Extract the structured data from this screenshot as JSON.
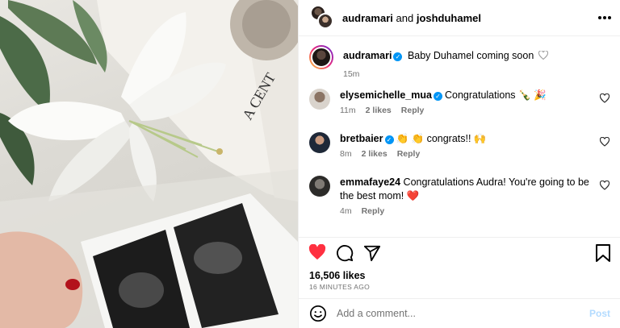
{
  "header": {
    "user1": "audramari",
    "conjunction": "and",
    "user2": "joshduhamel",
    "more_icon": "more-horizontal-icon"
  },
  "caption": {
    "username": "audramari",
    "text": "Baby Duhamel coming soon",
    "time": "15m"
  },
  "comments": [
    {
      "username": "elysemichelle_mua",
      "text": "Congratulations 🍾 🎉",
      "time": "11m",
      "likes": "2 likes",
      "reply": "Reply"
    },
    {
      "username": "bretbaier",
      "text": "👏 👏 congrats!! 🙌",
      "time": "8m",
      "likes": "2 likes",
      "reply": "Reply"
    },
    {
      "username": "emmafaye24",
      "text": "Congratulations Audra! You're going to be the best mom! ❤️",
      "time": "4m",
      "reply": "Reply"
    }
  ],
  "actions": {
    "likes": "16,506 likes",
    "ago": "16 MINUTES AGO",
    "add_placeholder": "Add a comment...",
    "post_label": "Post"
  },
  "colors": {
    "verified": "#0095f6",
    "like_red": "#ff3040",
    "muted": "#737373",
    "post_disabled": "#b3dbff"
  }
}
